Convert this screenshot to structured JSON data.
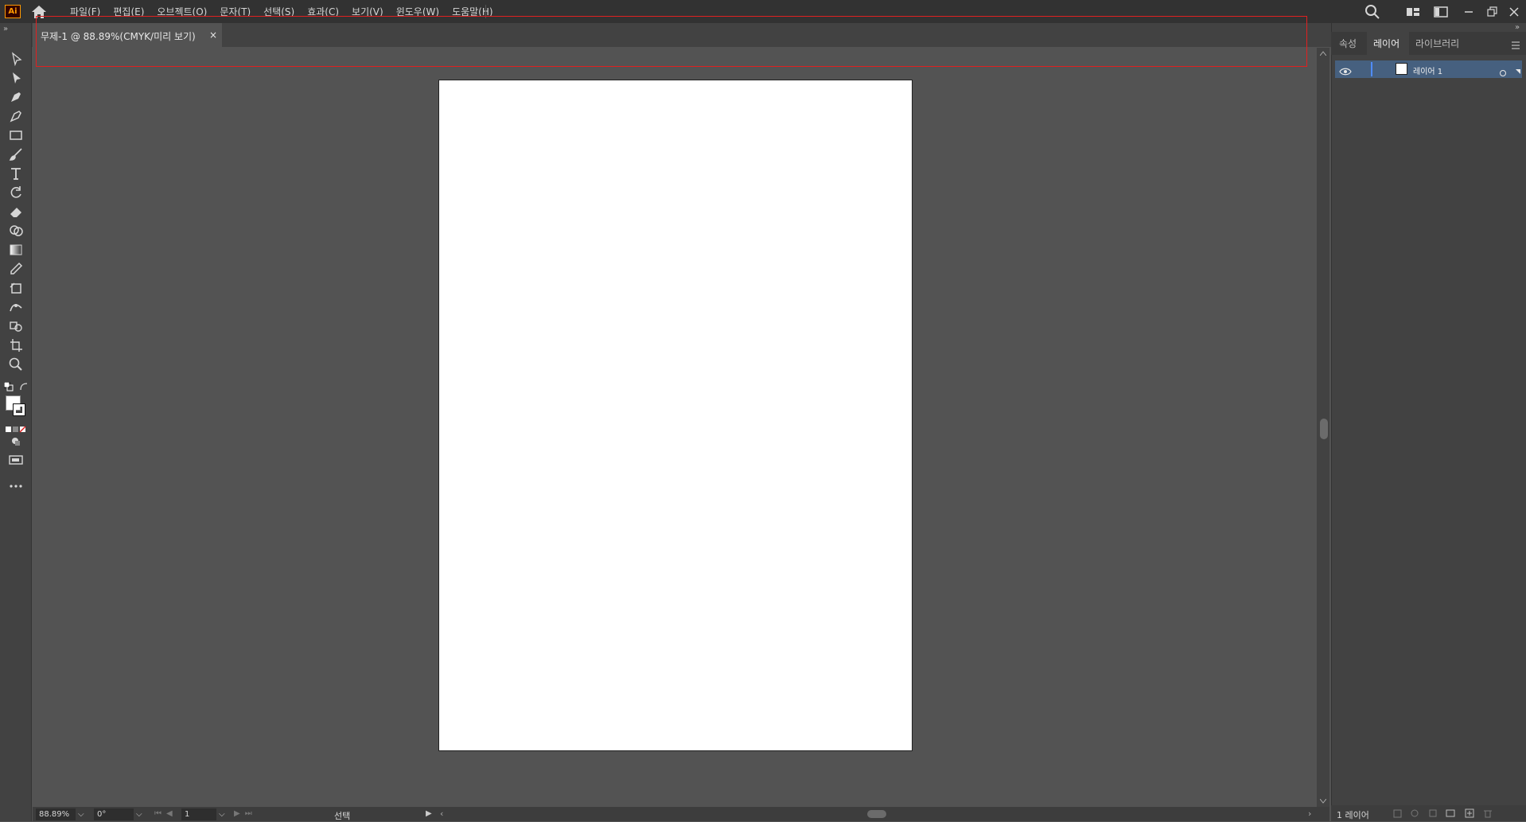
{
  "app": {
    "logo_text": "Ai"
  },
  "menu": {
    "items": [
      "파일(F)",
      "편집(E)",
      "오브젝트(O)",
      "문자(T)",
      "선택(S)",
      "효과(C)",
      "보기(V)",
      "윈도우(W)",
      "도움말(H)"
    ]
  },
  "document_tab": {
    "title": "무제-1 @ 88.89%(CMYK/미리 보기)",
    "close_glyph": "×"
  },
  "panel": {
    "tabs": [
      "속성",
      "레이어",
      "라이브러리"
    ],
    "active_tab": "레이어",
    "layer_name": "레이어 1",
    "layer_count": "1 레이어"
  },
  "status": {
    "zoom": "88.89%",
    "rotation": "0°",
    "artboard_number": "1",
    "current_tool": "선택"
  },
  "colors": {
    "highlight": "#e02020",
    "layer_selected": "#46607f",
    "app_logo": "#ff9a00"
  },
  "icons": [
    "home-icon",
    "search-icon",
    "arrange-documents-icon",
    "workspace-icon",
    "minimize-icon",
    "restore-icon",
    "close-icon"
  ]
}
